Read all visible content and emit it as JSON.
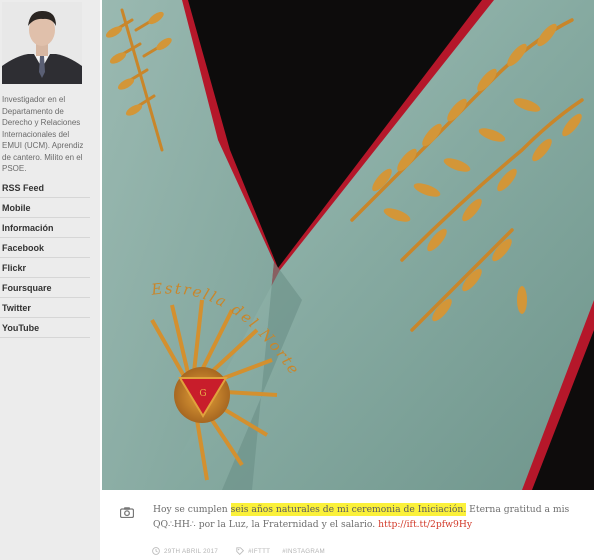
{
  "sidebar": {
    "bio": "Investigador en el Departamento de Derecho y Relaciones Internacionales del EMUI (UCM). Aprendiz de cantero. Milito en el PSOE.",
    "nav": [
      {
        "label": "RSS Feed"
      },
      {
        "label": "Mobile"
      },
      {
        "label": "Información"
      },
      {
        "label": "Facebook"
      },
      {
        "label": "Flickr"
      },
      {
        "label": "Foursquare"
      },
      {
        "label": "Twitter"
      },
      {
        "label": "YouTube"
      }
    ]
  },
  "post": {
    "caption_before": "Hoy se cumplen ",
    "caption_highlight": "seis años naturales de mi ceremonia de Iniciación.",
    "caption_after": " Eterna gratitud a mis QQ∴HH∴ por la Luz, la Fraternidad y el salario. ",
    "caption_link": "http://ift.tt/2pfw9Hy",
    "date": "29TH ABRIL 2017",
    "tag1": "#IFTTT",
    "tag2": "#INSTAGRAM",
    "photo_text": "Estrella del Norte"
  },
  "colors": {
    "background": "#ececec",
    "highlight": "#fbf13a",
    "link": "#d23a2a",
    "sash": "#8fb3ab",
    "ribbon": "#c0182b",
    "embroidery": "#c9862a"
  },
  "icons": {
    "post_type": "camera-icon",
    "date": "clock-icon",
    "tag": "tag-icon"
  }
}
